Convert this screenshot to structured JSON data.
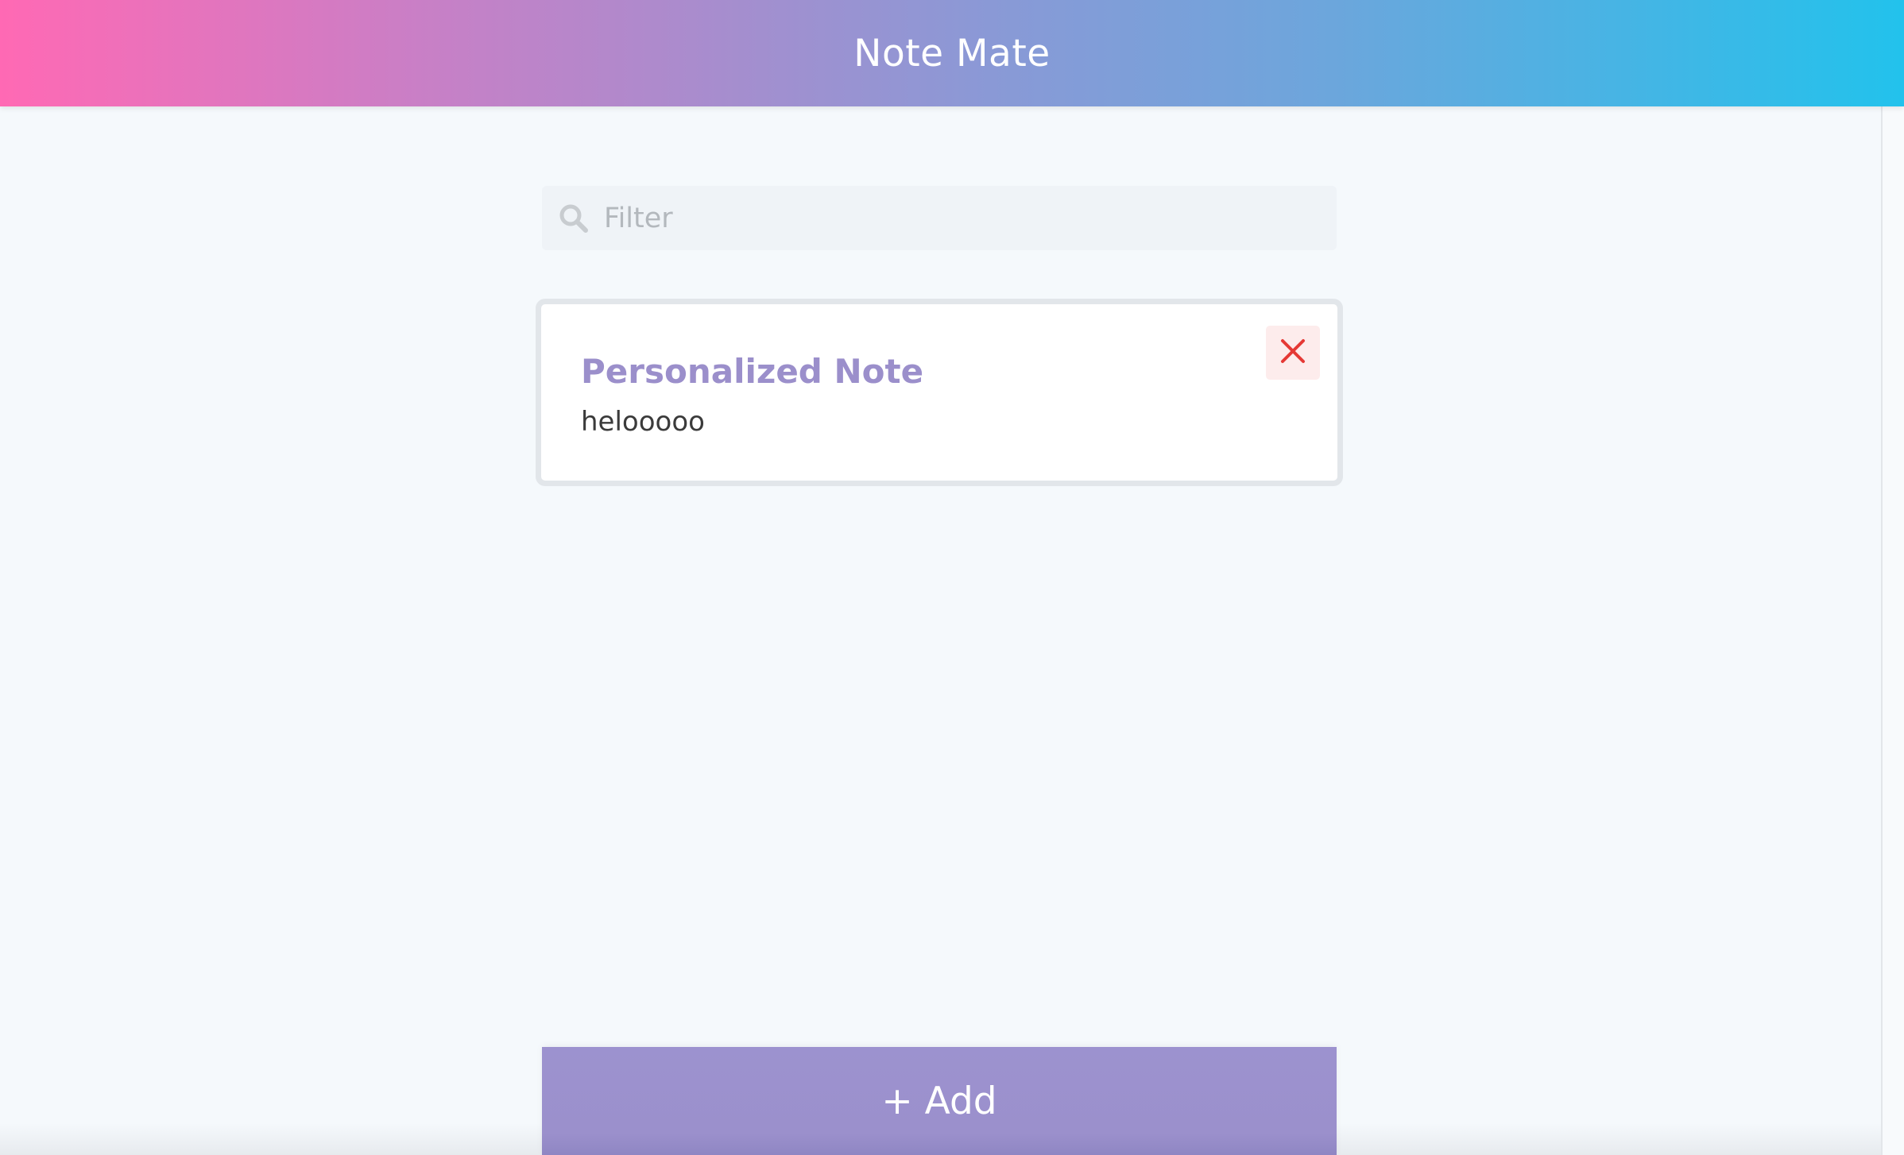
{
  "header": {
    "title": "Note Mate"
  },
  "filter": {
    "placeholder": "Filter",
    "value": "",
    "icon": "search-icon"
  },
  "notes": [
    {
      "title": "Personalized Note",
      "body": "helooooo",
      "delete_icon": "close-icon"
    }
  ],
  "add_button": {
    "label": "+ Add"
  },
  "colors": {
    "gradient_start": "#ff69b4",
    "gradient_end": "#22c2ec",
    "accent": "#9b8fcb",
    "delete": "#e53935",
    "background": "#f5f9fc"
  }
}
